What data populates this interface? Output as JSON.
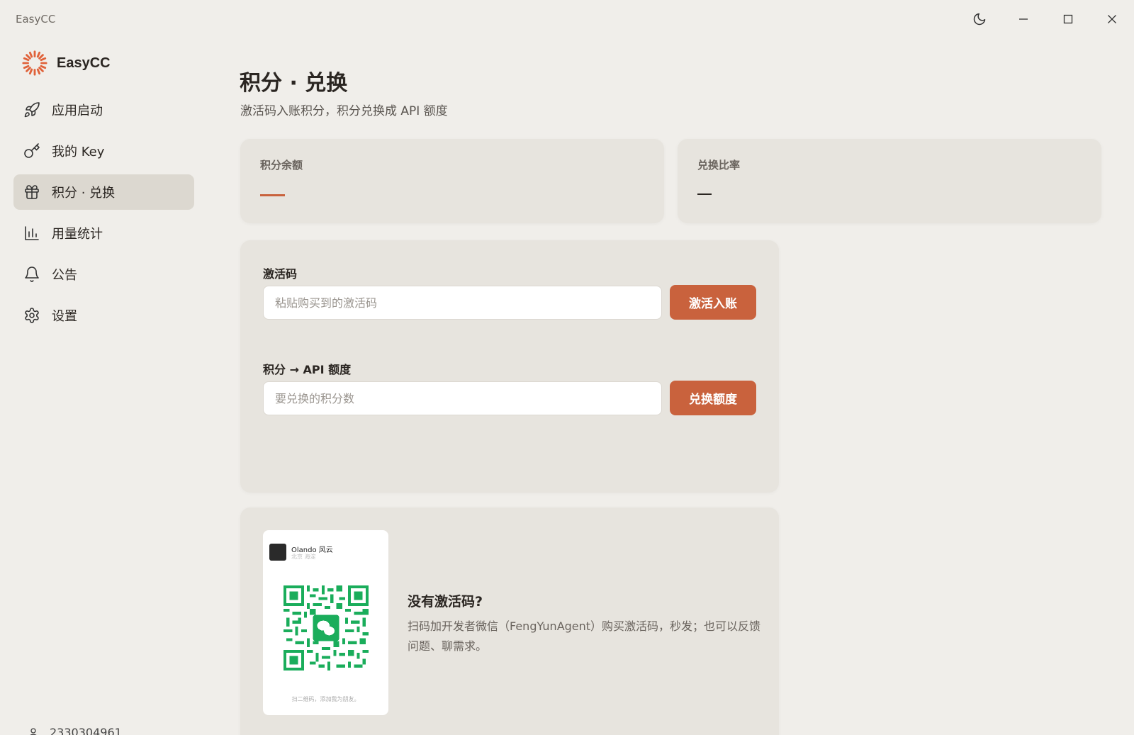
{
  "window": {
    "title": "EasyCC",
    "controls": [
      "moon-icon",
      "minimize-icon",
      "maximize-icon",
      "close-icon"
    ]
  },
  "brand": {
    "name": "EasyCC",
    "logo": "sun-burst-logo",
    "accent": "#e0623a"
  },
  "sidebar": {
    "items": [
      {
        "label": "应用启动",
        "icon": "rocket-icon"
      },
      {
        "label": "我的 Key",
        "icon": "key-icon"
      },
      {
        "label": "积分 · 兑换",
        "icon": "gift-icon",
        "active": true
      },
      {
        "label": "用量统计",
        "icon": "bar-chart-icon"
      },
      {
        "label": "公告",
        "icon": "bell-icon"
      },
      {
        "label": "设置",
        "icon": "gear-icon"
      }
    ],
    "user": {
      "id": "2330304961",
      "icon": "user-icon"
    }
  },
  "page": {
    "title": "积分 · 兑换",
    "subtitle": "激活码入账积分，积分兑换成 API 额度"
  },
  "stats": {
    "balance": {
      "label": "积分余额",
      "value": "—",
      "color": "#c9623d"
    },
    "rate": {
      "label": "兑换比率",
      "value": "—",
      "color": "#2b2622"
    }
  },
  "forms": {
    "activation": {
      "label": "激活码",
      "placeholder": "粘贴购买到的激活码",
      "button": "激活入账"
    },
    "exchange": {
      "label": "积分 → API 额度",
      "placeholder": "要兑换的积分数",
      "button": "兑换额度"
    }
  },
  "promo": {
    "qr": {
      "name": "Olando 风云",
      "location": "北京 海淀",
      "caption": "扫二维码，添加我为朋友。",
      "icon": "wechat-qr-code"
    },
    "title": "没有激活码?",
    "text": "扫码加开发者微信（FengYunAgent）购买激活码，秒发；也可以反馈问题、聊需求。"
  },
  "colors": {
    "accent": "#c9623d",
    "background": "#f0eeea",
    "card": "#e7e4de",
    "active_nav": "#dcd8d0"
  }
}
